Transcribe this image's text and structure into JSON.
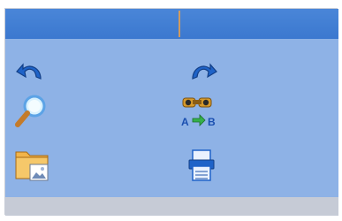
{
  "toolbar": {
    "tools": [
      {
        "name": "undo",
        "icon": "undo-icon"
      },
      {
        "name": "redo",
        "icon": "redo-icon"
      },
      {
        "name": "find",
        "icon": "magnifier-icon"
      },
      {
        "name": "find-replace",
        "icon": "binoculars-replace-icon",
        "label": "AB"
      },
      {
        "name": "insert-image",
        "icon": "folder-image-icon"
      },
      {
        "name": "print",
        "icon": "printer-icon"
      }
    ]
  },
  "colors": {
    "header": "#3b78cf",
    "panel": "#8eb2e6",
    "strip": "#c6cbd6",
    "icon_blue": "#1f63c8"
  }
}
